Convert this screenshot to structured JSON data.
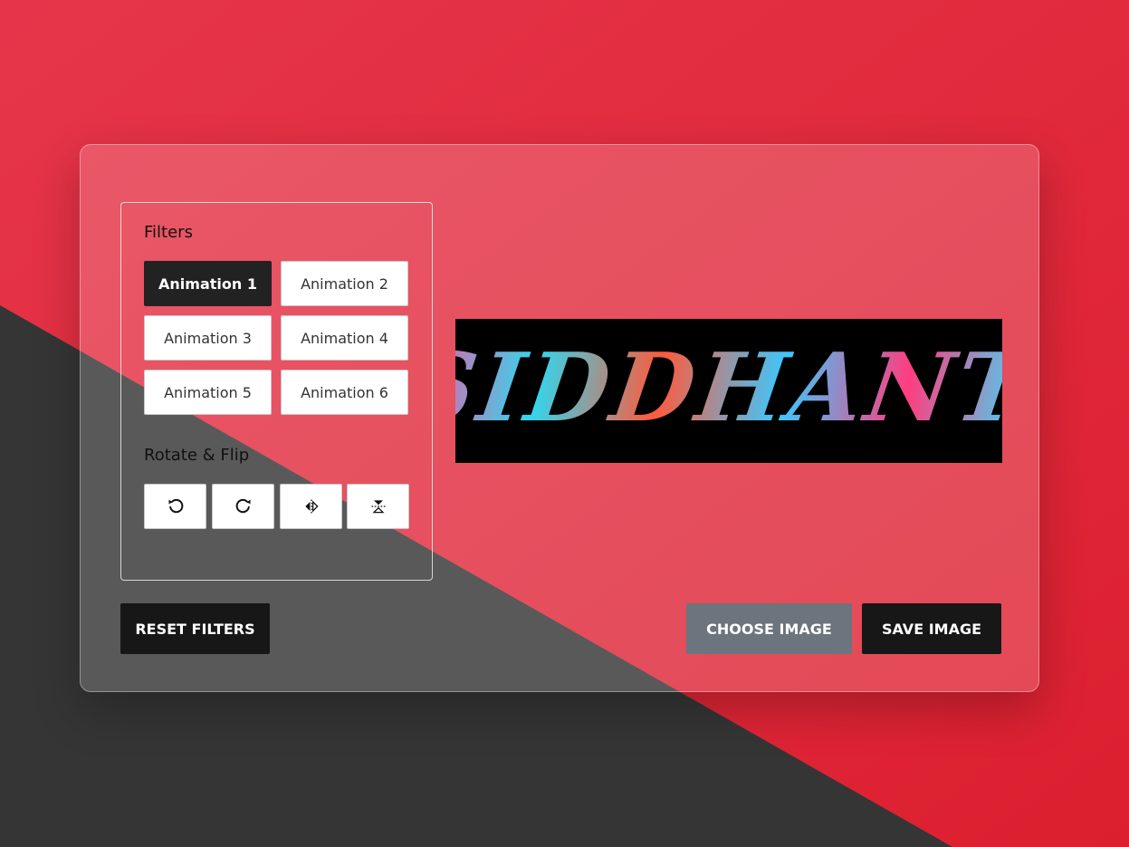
{
  "colors": {
    "background_red": "#e0283a",
    "background_dark": "#353535",
    "active_button": "#222222",
    "choose_button": "#6c757d",
    "dark_button": "#171717"
  },
  "controls": {
    "filters_title": "Filters",
    "filters": [
      {
        "label": "Animation 1",
        "active": true
      },
      {
        "label": "Animation 2",
        "active": false
      },
      {
        "label": "Animation 3",
        "active": false
      },
      {
        "label": "Animation 4",
        "active": false
      },
      {
        "label": "Animation 5",
        "active": false
      },
      {
        "label": "Animation 6",
        "active": false
      }
    ],
    "rotate_title": "Rotate & Flip",
    "rotate_buttons": [
      "rotate-left-icon",
      "rotate-right-icon",
      "flip-horizontal-icon",
      "flip-vertical-icon"
    ]
  },
  "preview": {
    "text": "SIDDHANT"
  },
  "actions": {
    "reset_label": "RESET FILTERS",
    "choose_label": "CHOOSE IMAGE",
    "save_label": "SAVE IMAGE"
  }
}
